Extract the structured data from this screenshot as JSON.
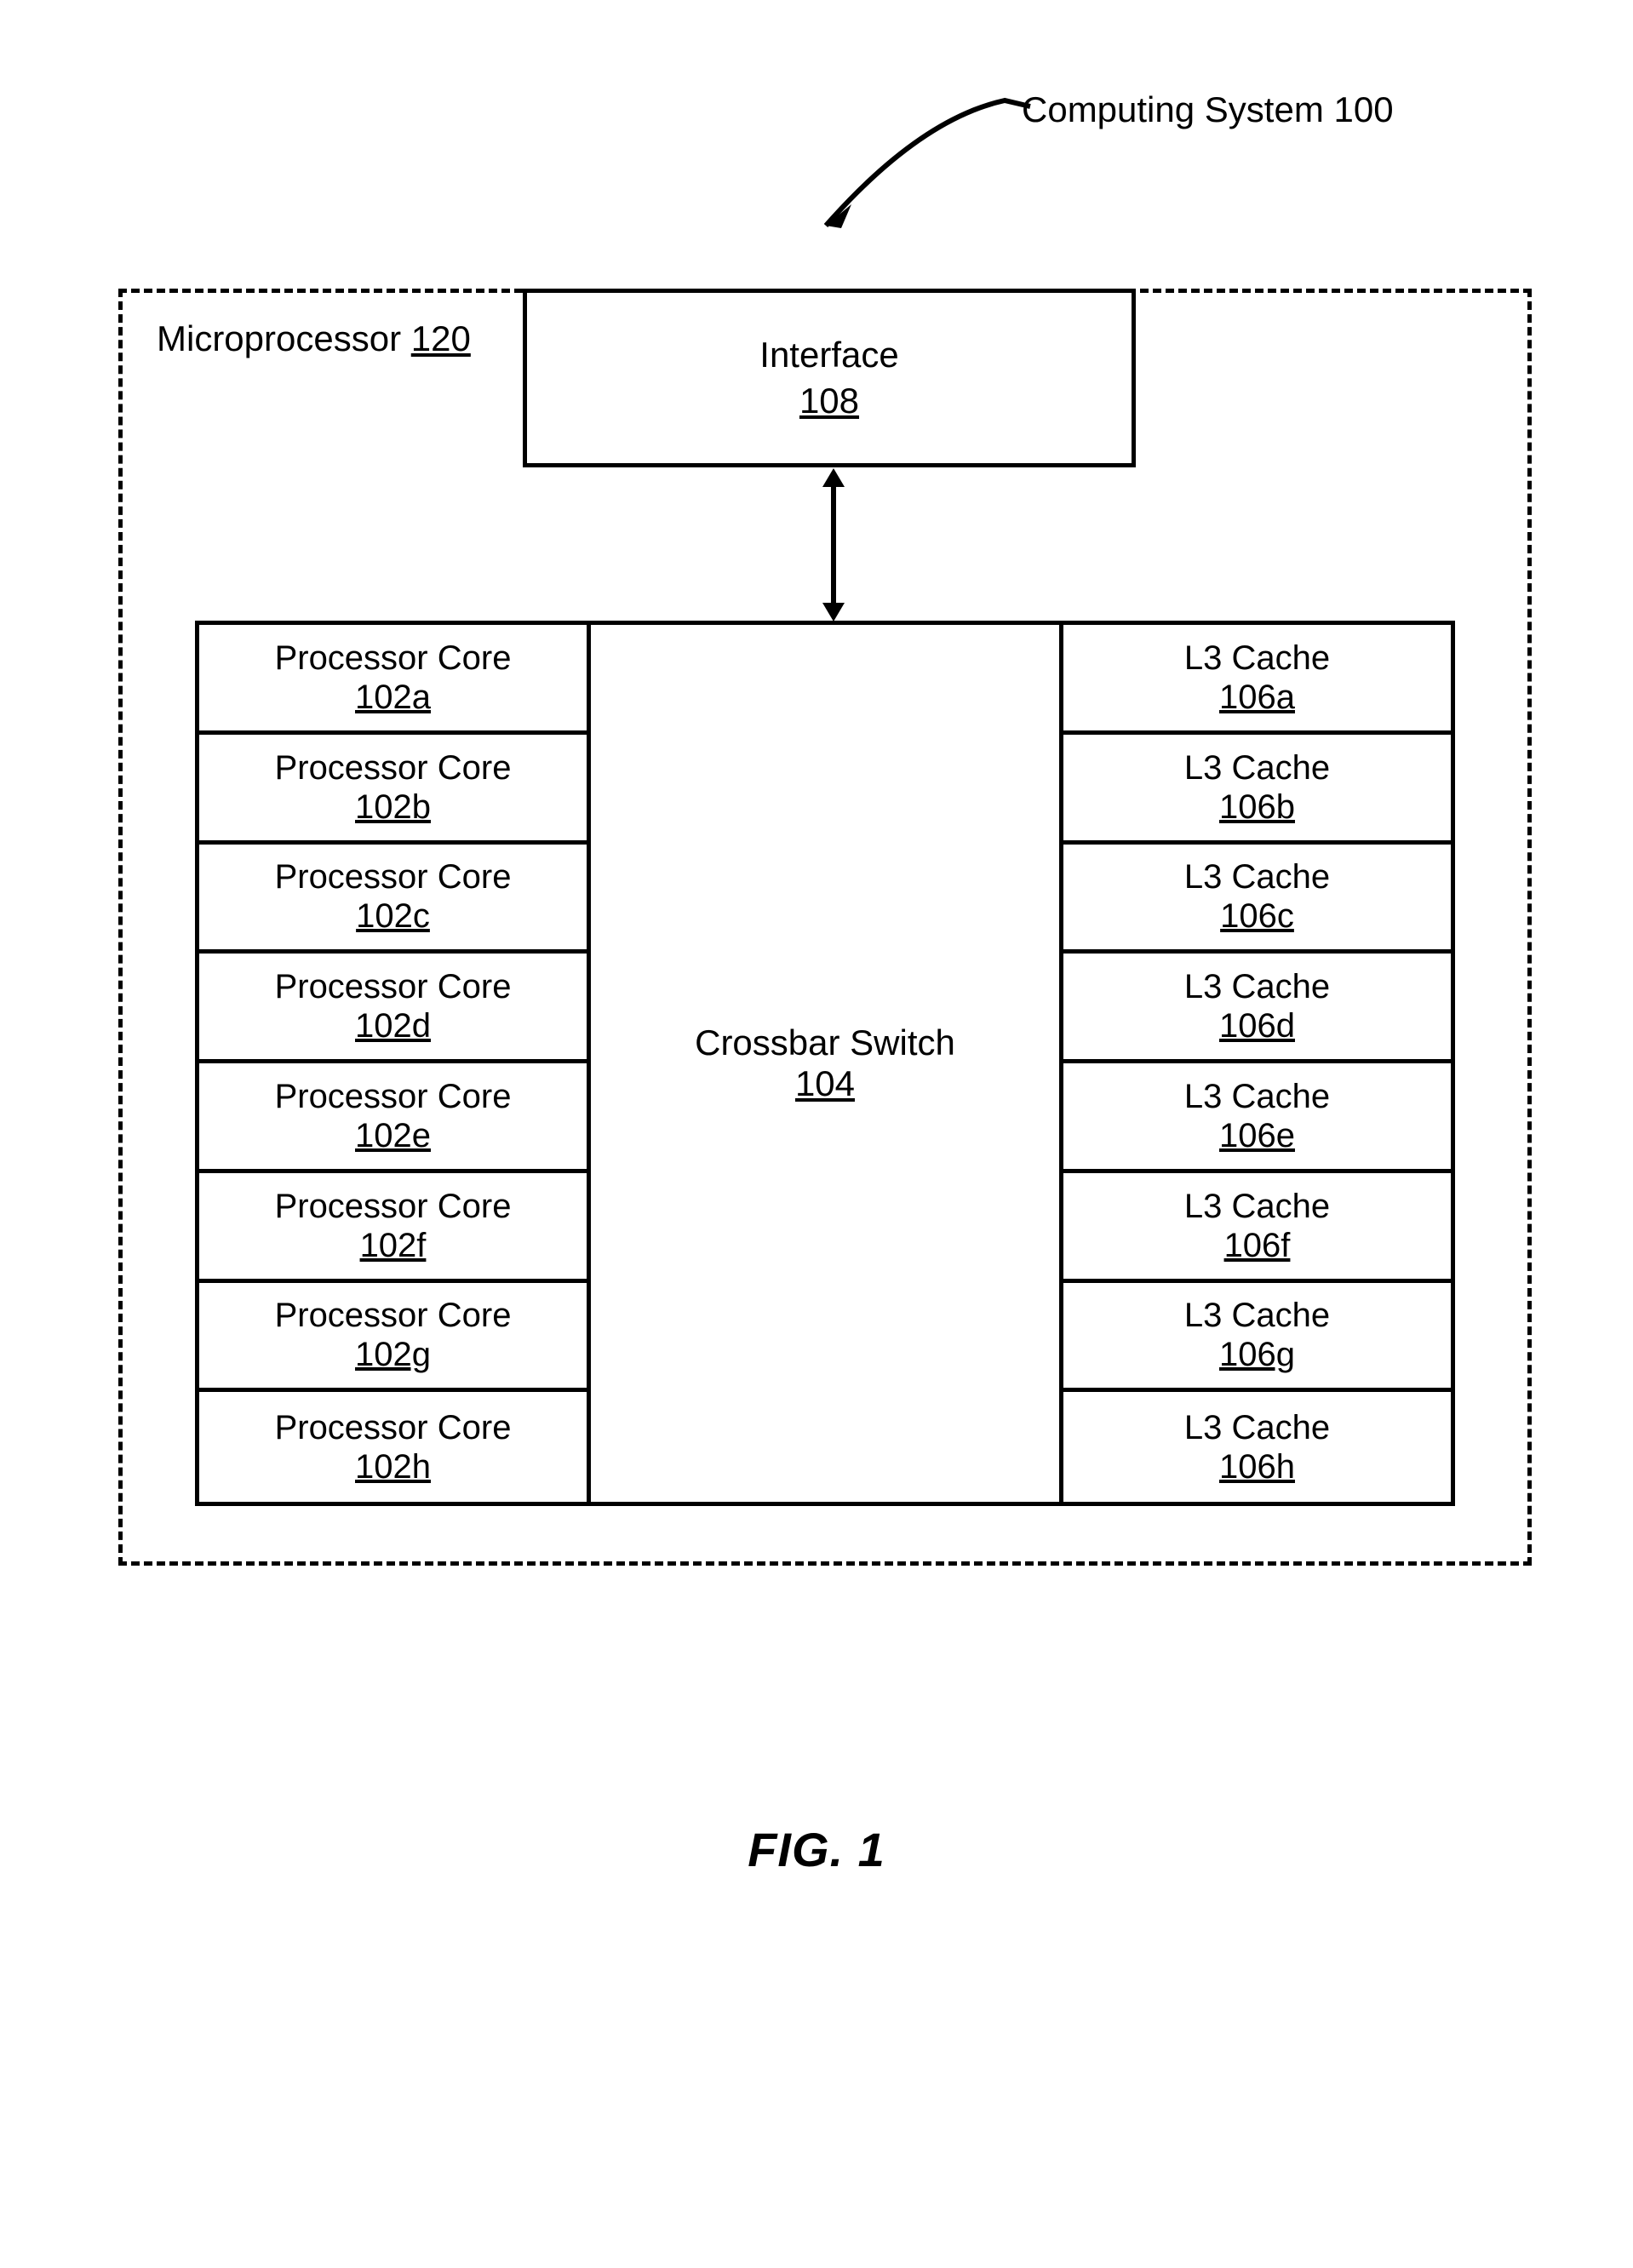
{
  "title": "Computing System 100",
  "figure_caption": "FIG. 1",
  "microprocessor": {
    "label": "Microprocessor",
    "number": "120"
  },
  "interface": {
    "label": "Interface",
    "number": "108"
  },
  "crossbar": {
    "label": "Crossbar Switch",
    "number": "104"
  },
  "cores": [
    {
      "label": "Processor Core",
      "number": "102a"
    },
    {
      "label": "Processor Core",
      "number": "102b"
    },
    {
      "label": "Processor Core",
      "number": "102c"
    },
    {
      "label": "Processor Core",
      "number": "102d"
    },
    {
      "label": "Processor Core",
      "number": "102e"
    },
    {
      "label": "Processor Core",
      "number": "102f"
    },
    {
      "label": "Processor Core",
      "number": "102g"
    },
    {
      "label": "Processor Core",
      "number": "102h"
    }
  ],
  "caches": [
    {
      "label": "L3 Cache",
      "number": "106a"
    },
    {
      "label": "L3 Cache",
      "number": "106b"
    },
    {
      "label": "L3 Cache",
      "number": "106c"
    },
    {
      "label": "L3 Cache",
      "number": "106d"
    },
    {
      "label": "L3 Cache",
      "number": "106e"
    },
    {
      "label": "L3 Cache",
      "number": "106f"
    },
    {
      "label": "L3 Cache",
      "number": "106g"
    },
    {
      "label": "L3 Cache",
      "number": "106h"
    }
  ]
}
